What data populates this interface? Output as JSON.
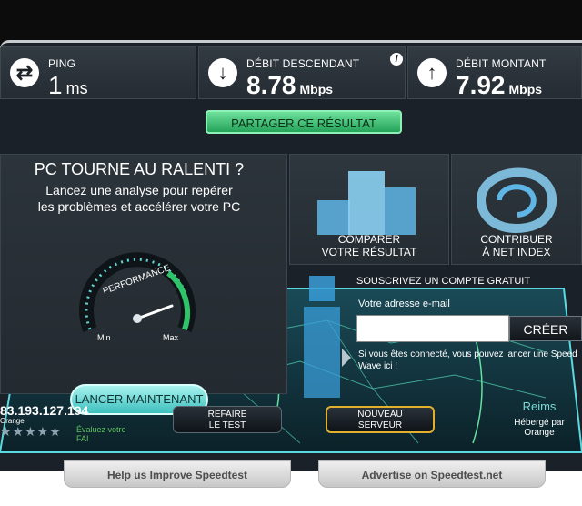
{
  "metrics": {
    "ping": {
      "label": "PING",
      "value": "1",
      "unit": "ms",
      "icon": "swap-arrows-icon"
    },
    "download": {
      "label": "DÉBIT DESCENDANT",
      "value": "8.78",
      "unit": "Mbps",
      "icon": "down-arrow-icon"
    },
    "upload": {
      "label": "DÉBIT MONTANT",
      "value": "7.92",
      "unit": "Mbps",
      "icon": "up-arrow-icon"
    }
  },
  "share_label": "PARTAGER CE RÉSULTAT",
  "promo": {
    "title": "PC TOURNE AU RALENTI ?",
    "subtitle_line1": "Lancez une analyse pour repérer",
    "subtitle_line2": "les problèmes et accélérer votre PC",
    "gauge_label": "PERFORMANCE",
    "gauge_min": "Min",
    "gauge_max": "Max",
    "button": "LANCER MAINTENANT"
  },
  "tiles": {
    "compare_line1": "COMPARER",
    "compare_line2": "VOTRE RÉSULTAT",
    "contrib_line1": "CONTRIBUER",
    "contrib_line2": "À NET INDEX"
  },
  "signup": {
    "title": "SOUSCRIVEZ UN COMPTE GRATUIT",
    "email_label": "Votre adresse e-mail",
    "email_value": "",
    "button": "CRÉER",
    "note": "Si vous êtes connecté, vous pouvez lancer une Speed Wave ici !"
  },
  "client": {
    "ip": "83.193.127.194",
    "isp": "Orange",
    "rate_line1": "Évaluez votre",
    "rate_line2": "FAI",
    "stars": "★★★★★"
  },
  "actions": {
    "retest_line1": "REFAIRE",
    "retest_line2": "LE TEST",
    "newserver_line1": "NOUVEAU",
    "newserver_line2": "SERVEUR"
  },
  "server": {
    "city": "Reims",
    "hosted_line1": "Hébergé par",
    "hosted_line2": "Orange"
  },
  "footer": {
    "help": "Help us Improve Speedtest",
    "advertise": "Advertise on Speedtest.net"
  },
  "colors": {
    "accent_green": "#2fc46a",
    "teal": "#5fd6d2",
    "gold": "#e2b02c"
  }
}
